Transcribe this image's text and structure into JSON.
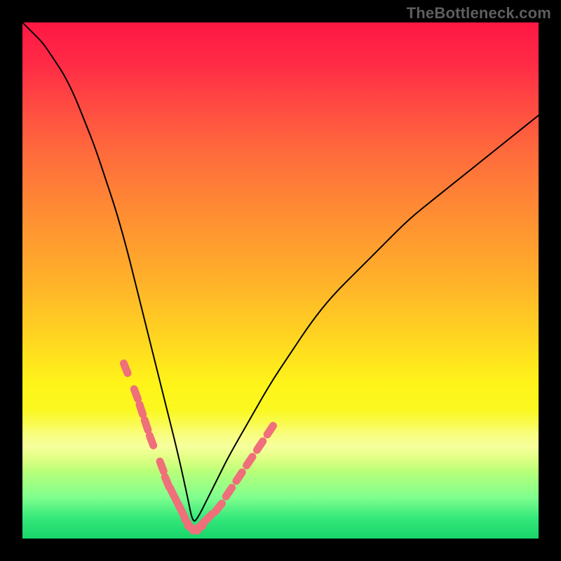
{
  "watermark": {
    "text": "TheBottleneck.com"
  },
  "colors": {
    "curve_stroke": "#000000",
    "marker_fill": "#ef6f7a",
    "marker_stroke": "#d85a65",
    "background_frame": "#000000"
  },
  "chart_data": {
    "type": "line",
    "title": "",
    "xlabel": "",
    "ylabel": "",
    "xlim": [
      0,
      100
    ],
    "ylim": [
      0,
      100
    ],
    "note": "V-shaped curve; y≈0 near x≈33; bottom ~5% band is green (optimal). Markers are clustered near the valley on both sides of the dip.",
    "series": [
      {
        "name": "bottleneck-curve",
        "x": [
          0,
          2,
          4,
          6,
          8,
          10,
          12,
          14,
          16,
          18,
          20,
          22,
          24,
          26,
          28,
          30,
          32,
          33,
          34,
          36,
          38,
          40,
          44,
          48,
          52,
          56,
          60,
          65,
          70,
          75,
          80,
          85,
          90,
          95,
          100
        ],
        "y": [
          100,
          98,
          96,
          93,
          90,
          86,
          81,
          76,
          70,
          64,
          57,
          49,
          41,
          33,
          25,
          17,
          8,
          3,
          4,
          8,
          12,
          16,
          23,
          30,
          36,
          42,
          47,
          52,
          57,
          62,
          66,
          70,
          74,
          78,
          82
        ]
      }
    ],
    "markers": {
      "name": "highlighted-points",
      "x": [
        20,
        22,
        23,
        24,
        25,
        27,
        28,
        29,
        30,
        31,
        32,
        33,
        34,
        35,
        36,
        38,
        40,
        42,
        44,
        46,
        48
      ],
      "y": [
        33,
        28,
        25,
        22,
        19,
        14,
        11,
        9,
        7,
        5,
        3,
        2,
        2,
        3,
        4,
        6,
        9,
        12,
        15,
        18,
        21
      ]
    }
  }
}
